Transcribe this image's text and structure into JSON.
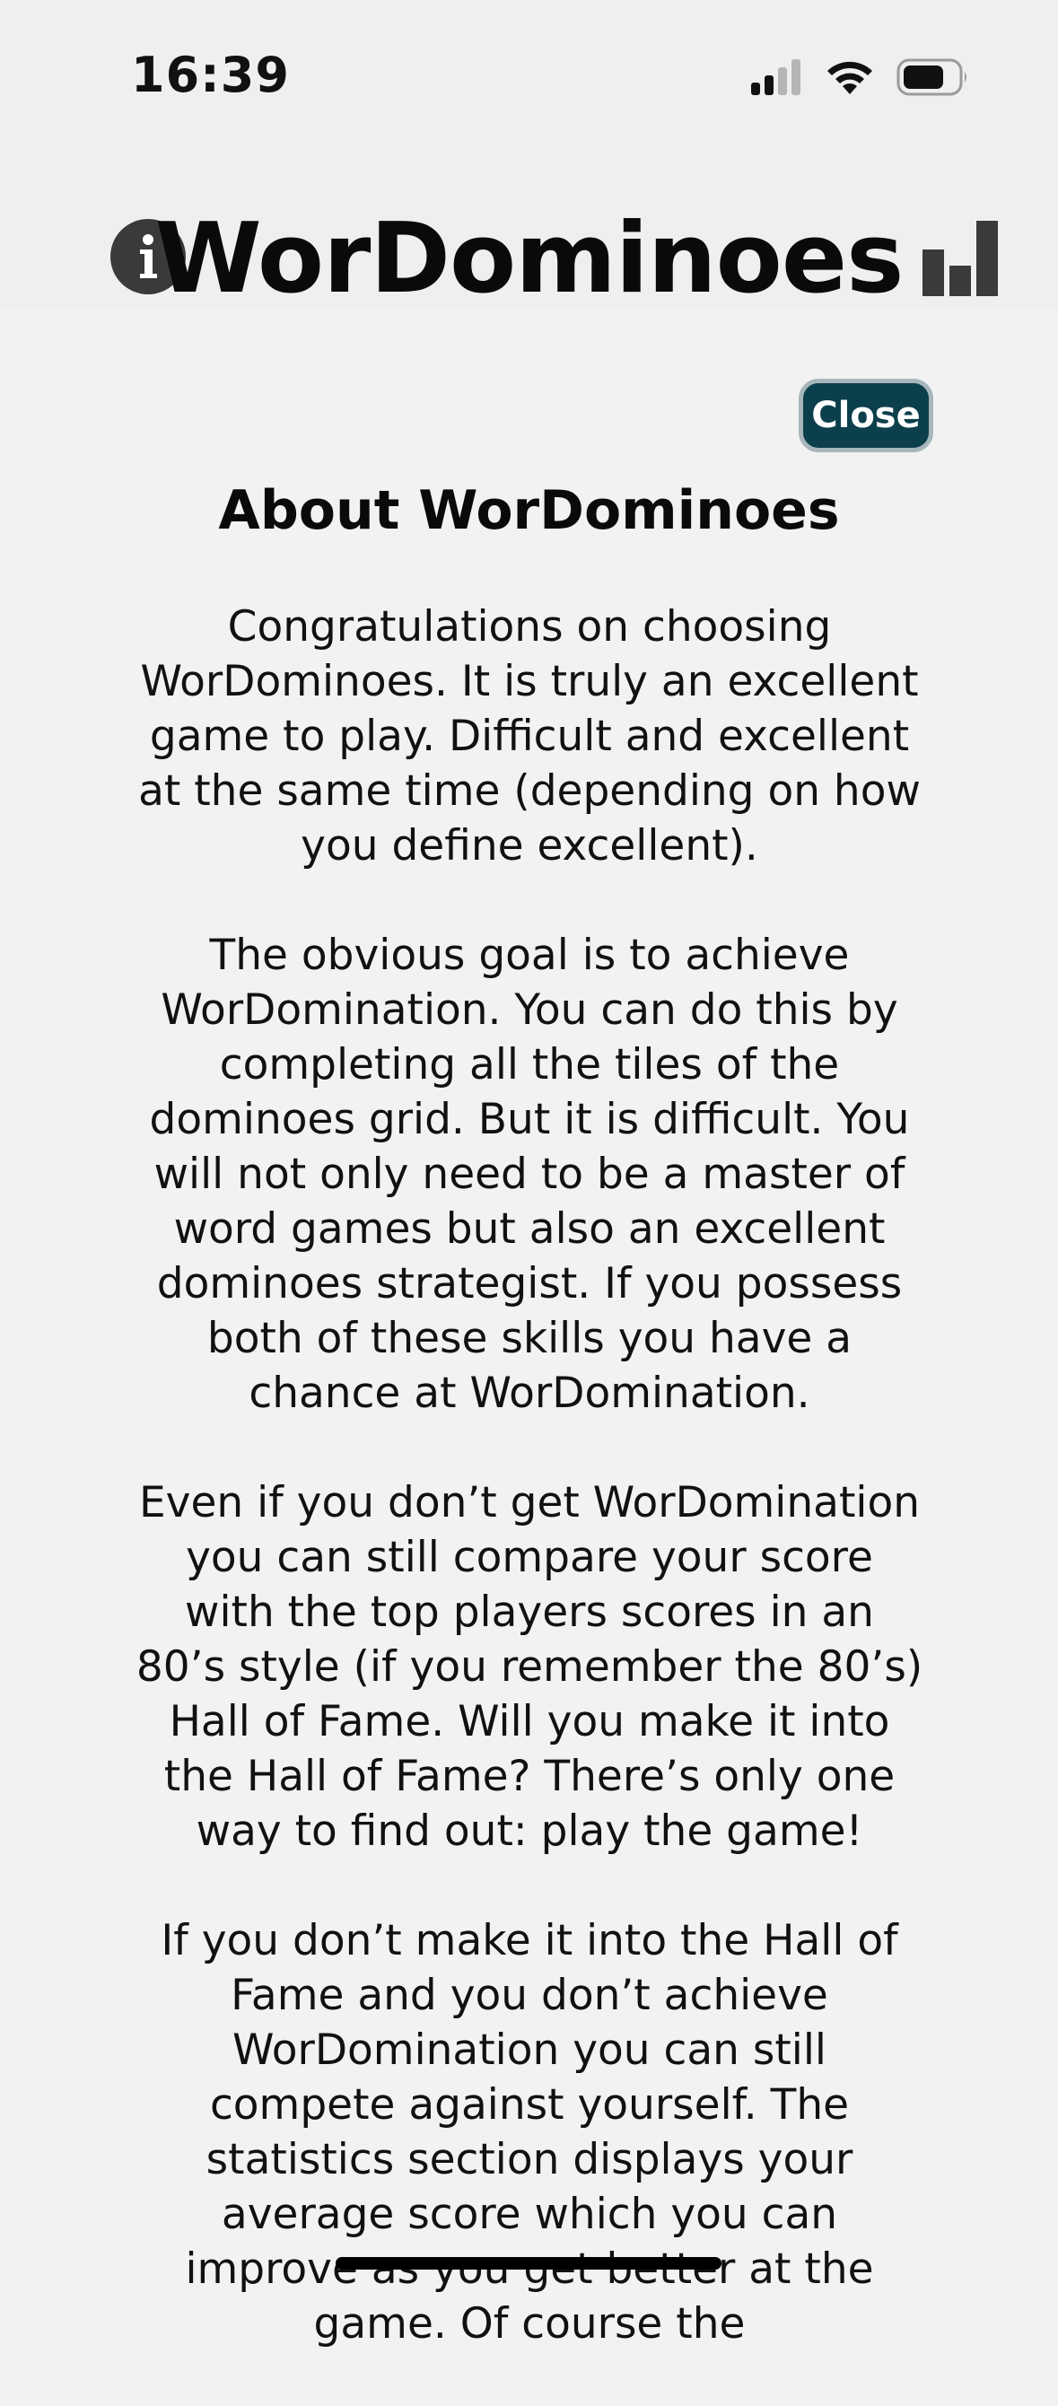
{
  "status_bar": {
    "time": "16:39",
    "icons": [
      "cellular-signal-icon",
      "wifi-icon",
      "battery-icon"
    ]
  },
  "header": {
    "title": "WorDominoes",
    "left_icon": "info-icon",
    "right_icon": "stats-bar-chart-icon"
  },
  "modal": {
    "close_label": "Close",
    "title": "About WorDominoes",
    "paragraphs": [
      "Congratulations on choosing WorDominoes. It is truly an excellent game to play. Difficult and excellent at the same time (depending on how you define excellent).",
      "The obvious goal is to achieve WorDomination. You can do this by completing all the tiles of the dominoes grid. But it is difficult. You will not only need to be a master of word games but also an excellent dominoes strategist. If you possess both of these skills you have a chance at WorDomination.",
      "Even if you don’t get WorDomination you can still compare your score with the top players scores in an 80’s style (if you remember the 80’s) Hall of Fame. Will you make it into the Hall of Fame? There’s only one way to find out: play the game!",
      "If you don’t make it into the Hall of Fame and you don’t achieve WorDomination you can still compete against yourself. The statistics section displays your average score which you can improve as you get better at the game. Of course the"
    ]
  },
  "colors": {
    "close_button_bg": "#0c3f4c",
    "close_button_border": "#a7b6bb",
    "icon_dark": "#3a3a3c",
    "background": "#f2f2f2"
  }
}
